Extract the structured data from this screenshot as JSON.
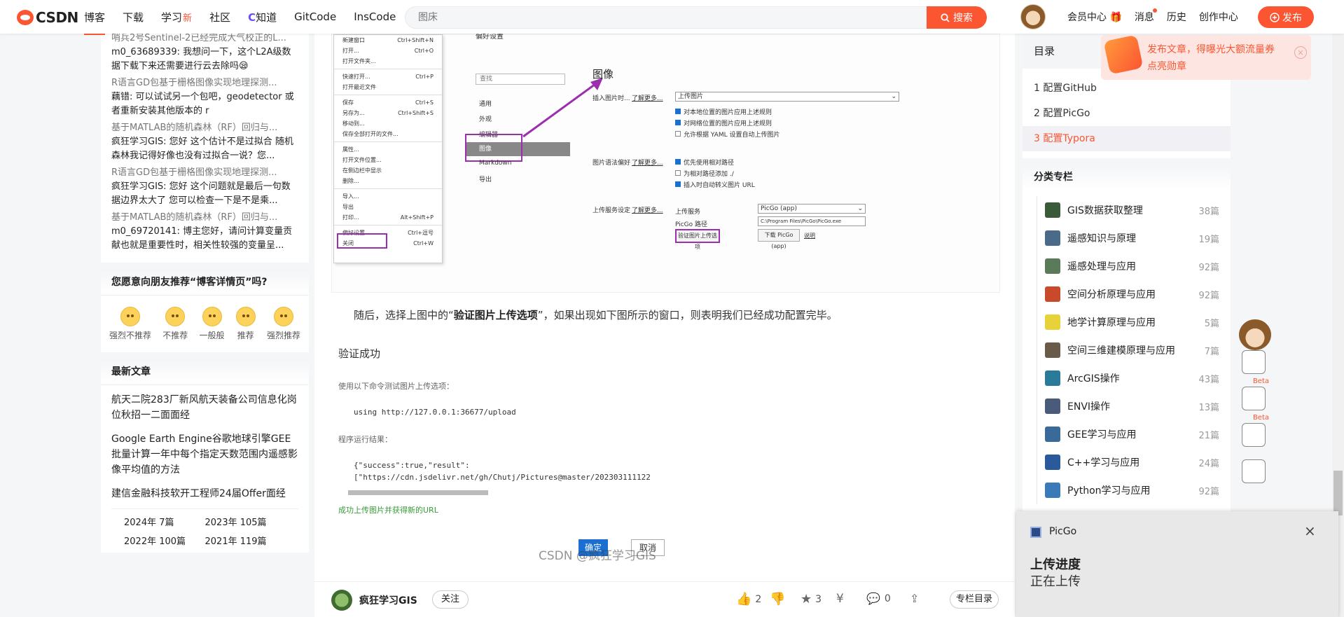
{
  "nav": {
    "logo_text": "CSDN",
    "links": [
      "博客",
      "下载",
      "学习",
      "社区",
      "知道",
      "GitCode",
      "InsCode"
    ],
    "learn_badge": "新",
    "search_placeholder": "图床",
    "search_button": "搜索",
    "right_links": [
      "会员中心",
      "消息",
      "历史",
      "创作中心"
    ],
    "publish": "发布"
  },
  "comments": [
    {
      "link": "哨兵2号Sentinel-2已经完成大气校正的L...",
      "text": "m0_63689339: 我想问一下，这个L2A级数据下载下来还需要进行云去除吗😪"
    },
    {
      "link": "R语言GD包基于栅格图像实现地理探测...",
      "text": "藕错: 可以试试另一个包吧，geodetector 或者重新安装其他版本的 r"
    },
    {
      "link": "基于MATLAB的随机森林（RF）回归与...",
      "text": "疯狂学习GIS: 您好 这个估计不是过拟合 随机森林我记得好像也没有过拟合一说？您..."
    },
    {
      "link": "R语言GD包基于栅格图像实现地理探测...",
      "text": "疯狂学习GIS: 您好 这个问题就是最后一句数据边界太大了 您可以检查一下是不是乘..."
    },
    {
      "link": "基于MATLAB的随机森林（RF）回归与...",
      "text": "m0_69720141: 博主您好，请问计算变量贡献也就是重要性时，相关性较强的变量呈..."
    }
  ],
  "recommend": {
    "title": "您愿意向朋友推荐“博客详情页”吗?",
    "options": [
      "强烈不推荐",
      "不推荐",
      "一般般",
      "推荐",
      "强烈推荐"
    ]
  },
  "latest": {
    "title": "最新文章",
    "articles": [
      "航天二院283厂新风航天装备公司信息化岗位秋招一二面面经",
      "Google Earth Engine谷歌地球引擎GEE批量计算一年中每个指定天数范围内遥感影像平均值的方法",
      "建信金融科技软开工程师24届Offer面经"
    ],
    "archive": [
      "2024年 7篇",
      "2023年 105篇",
      "2022年 100篇",
      "2021年 119篇"
    ]
  },
  "screenshot": {
    "menu": [
      [
        "新建窗口",
        "Ctrl+Shift+N"
      ],
      [
        "打开...",
        "Ctrl+O"
      ],
      [
        "打开文件夹...",
        ""
      ],
      [
        "",
        ""
      ],
      [
        "快速打开...",
        "Ctrl+P"
      ],
      [
        "打开最近文件",
        ""
      ],
      [
        "",
        ""
      ],
      [
        "保存",
        "Ctrl+S"
      ],
      [
        "另存为...",
        "Ctrl+Shift+S"
      ],
      [
        "移动到...",
        ""
      ],
      [
        "保存全部打开的文件...",
        ""
      ],
      [
        "",
        ""
      ],
      [
        "属性...",
        ""
      ],
      [
        "打开文件位置...",
        ""
      ],
      [
        "在侧边栏中显示",
        ""
      ],
      [
        "删除...",
        ""
      ],
      [
        "",
        ""
      ],
      [
        "导入...",
        ""
      ],
      [
        "导出",
        ""
      ],
      [
        "打印...",
        "Alt+Shift+P"
      ],
      [
        "",
        ""
      ],
      [
        "偏好设置...",
        "Ctrl+逗号"
      ],
      [
        "关闭",
        "Ctrl+W"
      ]
    ],
    "header": "偏好设置",
    "search": "查找",
    "categories": [
      "通用",
      "外观",
      "编辑器",
      "图像",
      "Markdown",
      "导出"
    ],
    "section_title": "图像",
    "insert_label": "插入图片时...",
    "learn_more": "了解更多...",
    "insert_select": "上传图片",
    "checks1": [
      "对本地位置的图片应用上述规则",
      "对网络位置的图片应用上述规则",
      "允许根据 YAML 设置自动上传图片"
    ],
    "syntax_label": "图片语法偏好",
    "checks2": [
      "优先使用相对路径",
      "为相对路径添加 ./",
      "插入时自动转义图片 URL"
    ],
    "service_label": "上传服务设定",
    "service_field": "上传服务",
    "service_value": "PicGo (app)",
    "path_label": "PicGo 路径",
    "path_value": "C:\\Program Files\\PicGo\\PicGo.exe",
    "verify_btn": "验证图片上传选项",
    "download_btn": "下载 PicGo (app)",
    "help": "说明"
  },
  "content": {
    "para_pre": "随后，选择上图中的“",
    "para_bold": "验证图片上传选项",
    "para_post": "”，如果出现如下图所示的窗口，则表明我们已经成功配置完毕。",
    "verify_title": "验证成功",
    "cmd_label": "使用以下命令测试图片上传选项：",
    "cmd": "using http://127.0.0.1:36677/upload",
    "result_label": "程序运行结果：",
    "result1": "{\"success\":true,\"result\":",
    "result2": "[\"https://cdn.jsdelivr.net/gh/Chutj/Pictures@master/202303111122",
    "success": "成功上传图片并获得新的URL",
    "watermark": "CSDN @疯狂学习GIS",
    "ok_btn": "确定",
    "cancel_btn": "取消"
  },
  "author": {
    "name": "疯狂学习GIS",
    "follow": "关注",
    "likes": "2",
    "stars": "3",
    "comments": "0",
    "toc_btn": "专栏目录"
  },
  "toc": {
    "title": "目录",
    "items": [
      "1 配置GitHub",
      "2 配置PicGo",
      "3 配置Typora"
    ]
  },
  "promo": {
    "line1": "发布文章，得曝光大额流量券",
    "line2": "点亮勋章"
  },
  "columns": {
    "title": "分类专栏",
    "items": [
      {
        "name": "GIS数据获取整理",
        "count": "38篇",
        "color": "#3a5a3a"
      },
      {
        "name": "遥感知识与原理",
        "count": "19篇",
        "color": "#4a6a8a"
      },
      {
        "name": "遥感处理与应用",
        "count": "92篇",
        "color": "#5a7a5a"
      },
      {
        "name": "空间分析原理与应用",
        "count": "92篇",
        "color": "#c84a2a"
      },
      {
        "name": "地学计算原理与应用",
        "count": "5篇",
        "color": "#e8d23a"
      },
      {
        "name": "空间三维建模原理与应用",
        "count": "7篇",
        "color": "#6a5a4a"
      },
      {
        "name": "ArcGIS操作",
        "count": "43篇",
        "color": "#2a7a9a"
      },
      {
        "name": "ENVI操作",
        "count": "13篇",
        "color": "#4a5a7a"
      },
      {
        "name": "GEE学习与应用",
        "count": "21篇",
        "color": "#3a6a9a"
      },
      {
        "name": "C++学习与应用",
        "count": "24篇",
        "color": "#2a5a9a"
      },
      {
        "name": "Python学习与应用",
        "count": "92篇",
        "color": "#3a7ab8"
      }
    ]
  },
  "popup": {
    "app": "PicGo",
    "title": "上传进度",
    "status": "正在上传"
  },
  "sidebar": {
    "beta": "Beta"
  }
}
